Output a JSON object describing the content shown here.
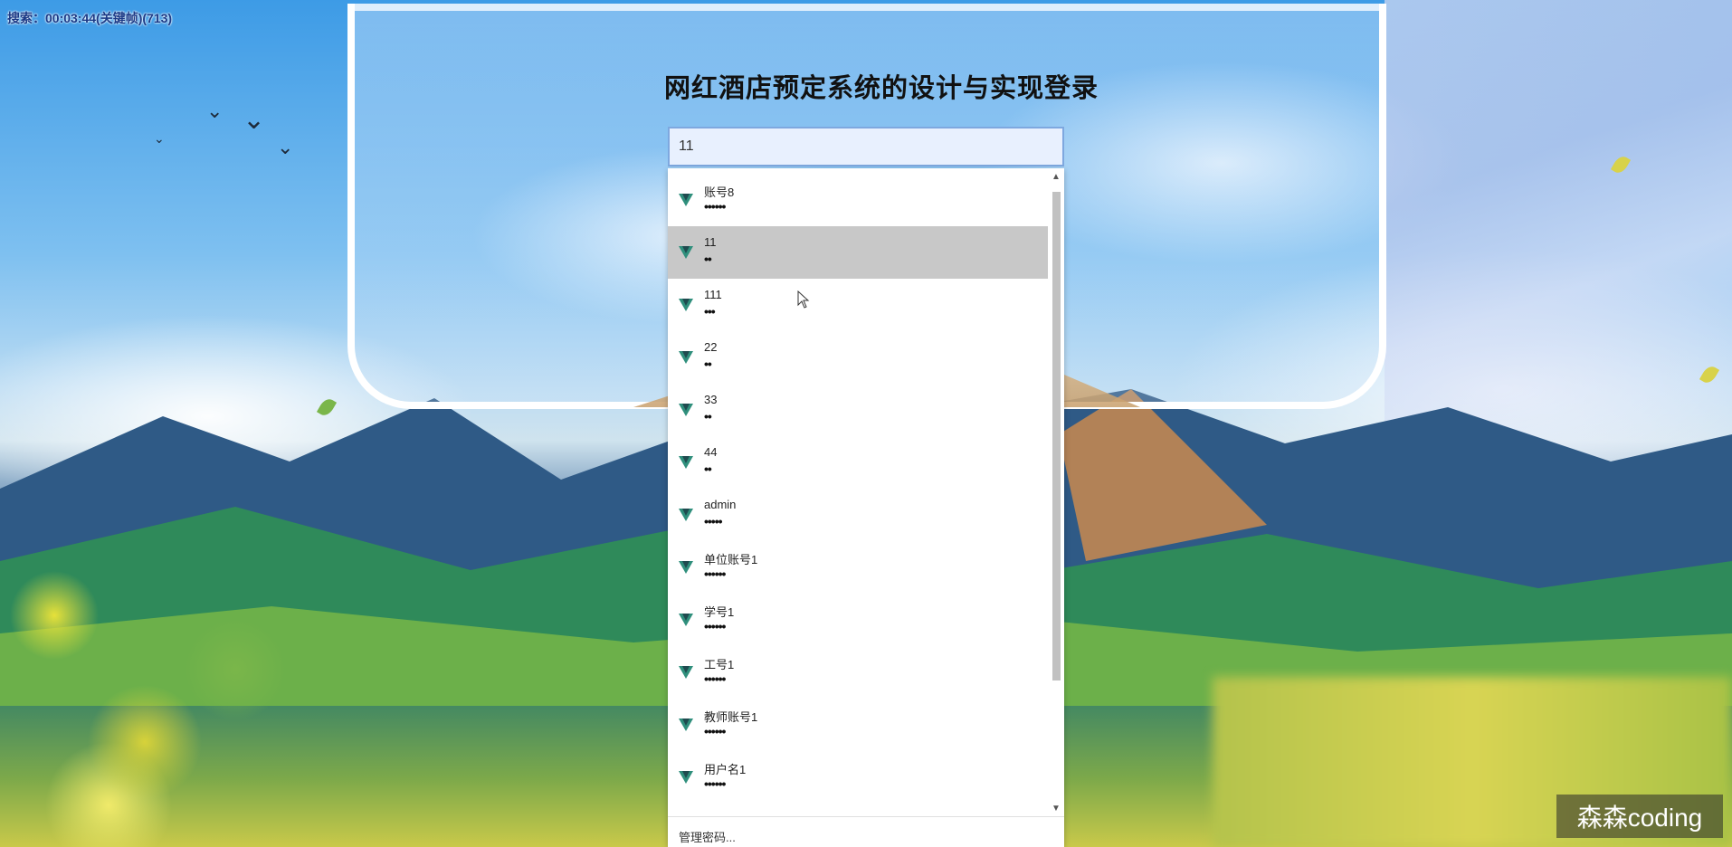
{
  "overlay": {
    "top_left_caption": "搜索：00:03:44(关键帧)(713)",
    "watermark": "森森coding"
  },
  "page": {
    "title": "网红酒店预定系统的设计与实现登录"
  },
  "username_field": {
    "value": "11"
  },
  "autocomplete": {
    "items": [
      {
        "username": "账号8",
        "password_mask": "••••••"
      },
      {
        "username": "11",
        "password_mask": "••"
      },
      {
        "username": "111",
        "password_mask": "•••"
      },
      {
        "username": "22",
        "password_mask": "••"
      },
      {
        "username": "33",
        "password_mask": "••"
      },
      {
        "username": "44",
        "password_mask": "••"
      },
      {
        "username": "admin",
        "password_mask": "•••••"
      },
      {
        "username": "单位账号1",
        "password_mask": "••••••"
      },
      {
        "username": "学号1",
        "password_mask": "••••••"
      },
      {
        "username": "工号1",
        "password_mask": "••••••"
      },
      {
        "username": "教师账号1",
        "password_mask": "••••••"
      },
      {
        "username": "用户名1",
        "password_mask": "••••••"
      }
    ],
    "selected_index": 1,
    "footer_label": "管理密码...",
    "icon": "password-manager-icon",
    "icon_colors": [
      "#2f8f7c",
      "#1f4b4f"
    ]
  },
  "colors": {
    "input_border": "#7ea8df",
    "input_bg": "#e8f0fe",
    "selected_row": "#c8c8c8"
  }
}
